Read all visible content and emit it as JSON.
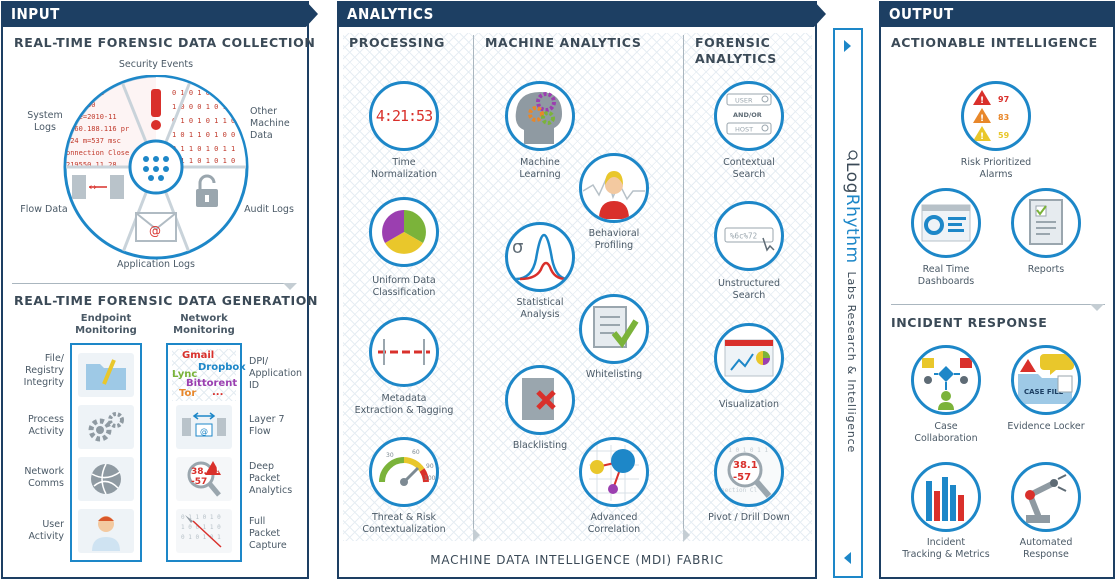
{
  "input": {
    "header": "INPUT",
    "collection_title": "REAL-TIME FORENSIC DATA COLLECTION",
    "wheel": {
      "security_events": "Security Events",
      "system_logs": "System\nLogs",
      "other_machine_data": "Other\nMachine\nData",
      "flow_data": "Flow Data",
      "audit_logs": "Audit Logs",
      "application_logs": "Application Logs"
    },
    "generation_title": "REAL-TIME FORENSIC DATA GENERATION",
    "endpoint_monitoring": "Endpoint\nMonitoring",
    "network_monitoring": "Network\nMonitoring",
    "left_rows": [
      "File/\nRegistry\nIntegrity",
      "Process\nActivity",
      "Network\nComms",
      "User\nActivity"
    ],
    "right_rows": [
      "DPI/\nApplication\nID",
      "Layer 7\nFlow",
      "Deep\nPacket\nAnalytics",
      "Full\nPacket\nCapture"
    ],
    "network_apps": [
      "Gmail",
      "Dropbox",
      "Lync",
      "Bittorent",
      "Tor",
      "..."
    ]
  },
  "analytics": {
    "header": "ANALYTICS",
    "processing_title": "PROCESSING",
    "machine_title": "MACHINE ANALYTICS",
    "forensic_title": "FORENSIC\nANALYTICS",
    "clock": "4:21:53",
    "processing_items": [
      "Time\nNormalization",
      "Uniform Data\nClassification",
      "Metadata\nExtraction & Tagging",
      "Threat & Risk\nContextualization"
    ],
    "gauge_ticks": [
      "30",
      "60",
      "90",
      "100"
    ],
    "machine_items": [
      "Machine\nLearning",
      "Behavioral\nProfiling",
      "Statistical\nAnalysis",
      "Whitelisting",
      "Blacklisting",
      "Advanced\nCorrelation"
    ],
    "sigma": "σ",
    "forensic_items": [
      "Contextual\nSearch",
      "Unstructured\nSearch",
      "Visualization",
      "Pivot / Drill Down"
    ],
    "search_fields": [
      "USER",
      "AND/OR",
      "HOST"
    ],
    "unstructured_query": "%6c%72",
    "pivot_text": "38.1\n-57",
    "footer": "MACHINE DATA INTELLIGENCE (MDI) FABRIC"
  },
  "brand": {
    "logo_a": "Log",
    "logo_b": "Rhythm",
    "tagline": "Labs Research & Intelligence"
  },
  "output": {
    "header": "OUTPUT",
    "actionable_title": "ACTIONABLE INTELLIGENCE",
    "alarm_values": [
      "97",
      "83",
      "59"
    ],
    "actionable_items": [
      "Risk Prioritized\nAlarms",
      "Real Time\nDashboards",
      "Reports"
    ],
    "incident_title": "INCIDENT RESPONSE",
    "case_file": "CASE FILE",
    "incident_items": [
      "Case\nCollaboration",
      "Evidence Locker",
      "Incident\nTracking & Metrics",
      "Automated\nResponse"
    ]
  },
  "colors": {
    "navy": "#1d3f63",
    "blue": "#1d87c8",
    "red": "#d9302b",
    "orange": "#e8872a",
    "green": "#7bb33a",
    "yellow": "#e9c72b",
    "purple": "#9b3fb0"
  }
}
